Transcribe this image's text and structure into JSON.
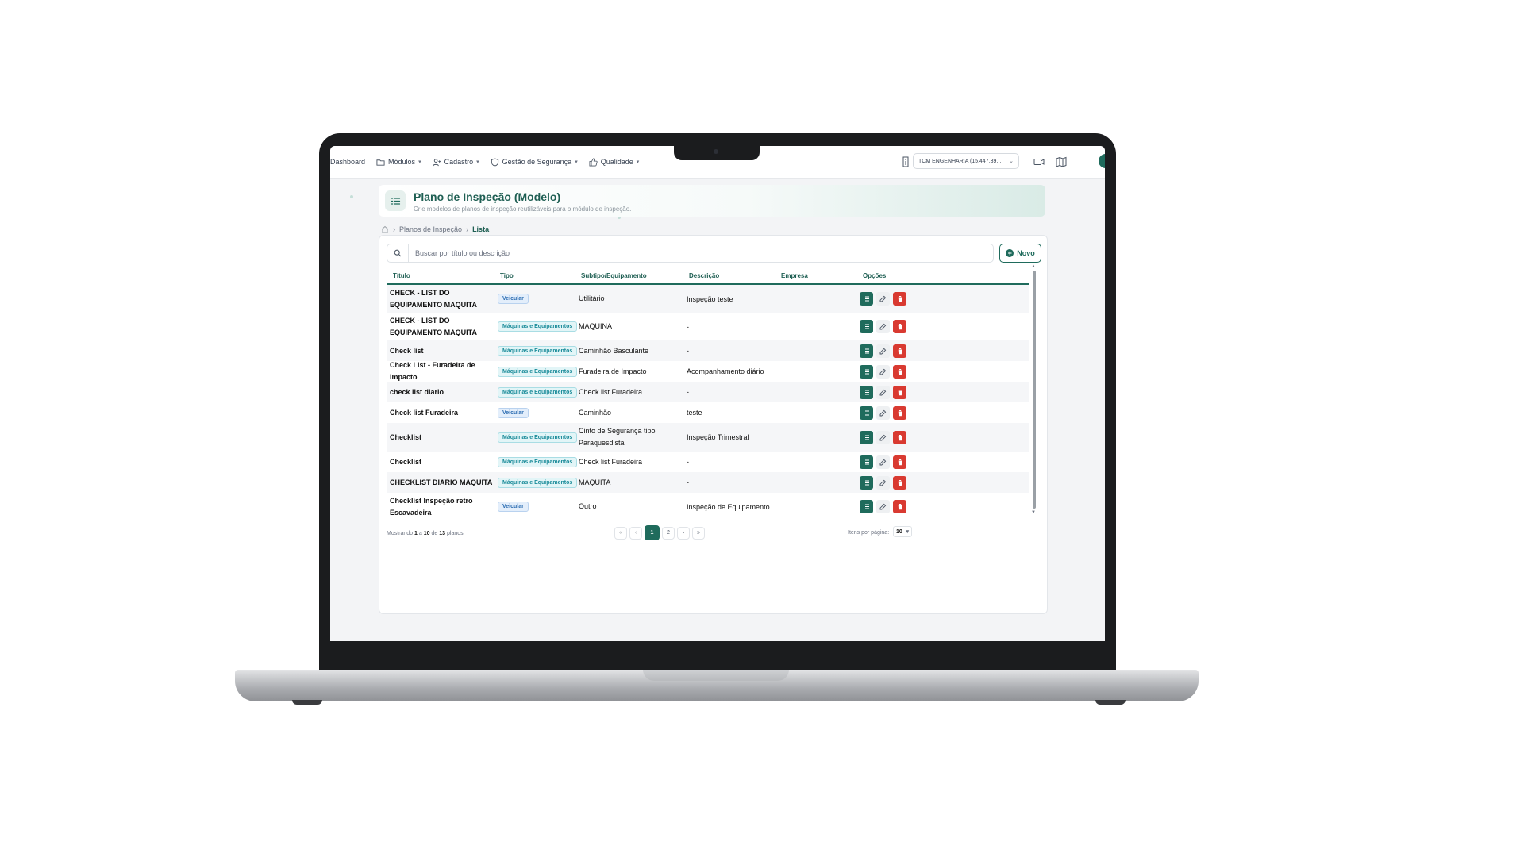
{
  "nav": {
    "dashboard": "Dashboard",
    "modulos": "Módulos",
    "cadastro": "Cadastro",
    "gestao": "Gestão de Segurança",
    "qualidade": "Qualidade",
    "company": "TCM ENGENHARIA (15.447.39..."
  },
  "header": {
    "title": "Plano de Inspeção (Modelo)",
    "subtitle": "Crie modelos de planos de inspeção reutilizáveis para o módulo de inspeção."
  },
  "breadcrumb": {
    "section": "Planos de Inspeção",
    "current": "Lista"
  },
  "search": {
    "placeholder": "Buscar por título ou descrição"
  },
  "new_button": "Novo",
  "table": {
    "headers": {
      "titulo": "Título",
      "tipo": "Tipo",
      "subtipo": "Subtipo/Equipamento",
      "descricao": "Descrição",
      "empresa": "Empresa",
      "opcoes": "Opções"
    },
    "rows": [
      {
        "titulo": "CHECK - LIST DO EQUIPAMENTO MAQUITA",
        "tipo": "Veicular",
        "subtipo": "Utilitário",
        "descricao": "Inspeção teste"
      },
      {
        "titulo": "CHECK - LIST DO EQUIPAMENTO MAQUITA",
        "tipo": "Máquinas e Equipamentos",
        "subtipo": "MAQUINA",
        "descricao": "-"
      },
      {
        "titulo": "Check list",
        "tipo": "Máquinas e Equipamentos",
        "subtipo": "Caminhão Basculante",
        "descricao": "-"
      },
      {
        "titulo": "Check List - Furadeira de Impacto",
        "tipo": "Máquinas e Equipamentos",
        "subtipo": "Furadeira de Impacto",
        "descricao": "Acompanhamento diário"
      },
      {
        "titulo": "check list diario",
        "tipo": "Máquinas e Equipamentos",
        "subtipo": "Check list Furadeira",
        "descricao": "-"
      },
      {
        "titulo": "Check list Furadeira",
        "tipo": "Veicular",
        "subtipo": "Caminhão",
        "descricao": "teste"
      },
      {
        "titulo": "Checklist",
        "tipo": "Máquinas e Equipamentos",
        "subtipo": "Cinto de Segurança tipo Paraquesdista",
        "descricao": "Inspeção Trimestral"
      },
      {
        "titulo": "Checklist",
        "tipo": "Máquinas e Equipamentos",
        "subtipo": "Check list Furadeira",
        "descricao": "-"
      },
      {
        "titulo": "CHECKLIST DIARIO MAQUITA",
        "tipo": "Máquinas e Equipamentos",
        "subtipo": "MAQUITA",
        "descricao": "-"
      },
      {
        "titulo": "Checklist Inspeção retro Escavadeira",
        "tipo": "Veicular",
        "subtipo": "Outro",
        "descricao": "Inspeção de Equipamento ..."
      }
    ]
  },
  "footer": {
    "showing_prefix": "Mostrando",
    "from": "1",
    "to_word": "a",
    "to": "10",
    "of_word": "de",
    "total": "13",
    "suffix": "planos",
    "pages": [
      "1",
      "2"
    ],
    "current_page": "1",
    "per_page_label": "Itens por página:",
    "per_page": "10"
  },
  "colors": {
    "primary": "#1f6b5c",
    "danger": "#d93a31",
    "veicular_tag": "#2f6fb3",
    "maquinas_tag": "#1b8c9a"
  }
}
